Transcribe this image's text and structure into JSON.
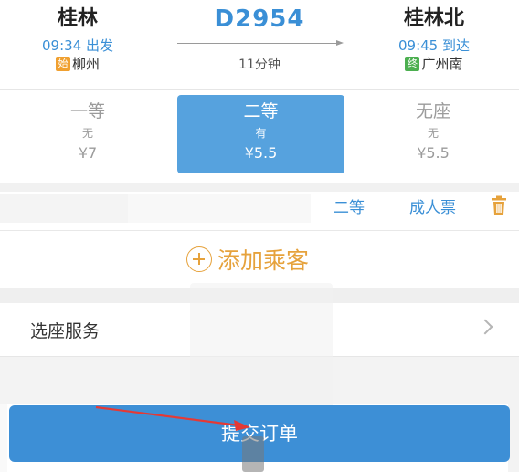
{
  "trip": {
    "from_station": "桂林",
    "to_station": "桂林北",
    "train_number": "D2954",
    "departure_time": "09:34 出发",
    "arrival_time": "09:45 到达",
    "duration": "11分钟",
    "origin_tag": "始",
    "origin_city": "柳州",
    "terminal_tag": "终",
    "terminal_city": "广州南"
  },
  "seats": [
    {
      "label": "一等",
      "availability": "无",
      "price": "¥7",
      "selected": false
    },
    {
      "label": "二等",
      "availability": "有",
      "price": "¥5.5",
      "selected": true
    },
    {
      "label": "无座",
      "availability": "无",
      "price": "¥5.5",
      "selected": false
    }
  ],
  "passenger": {
    "seat_class": "二等",
    "ticket_type": "成人票"
  },
  "add_passenger_label": "添加乘客",
  "seat_service_label": "选座服务",
  "submit_label": "提交订单",
  "colors": {
    "accent_blue": "#3a8fd6",
    "add_orange": "#e6a23c",
    "annotation_red": "#e53935"
  }
}
